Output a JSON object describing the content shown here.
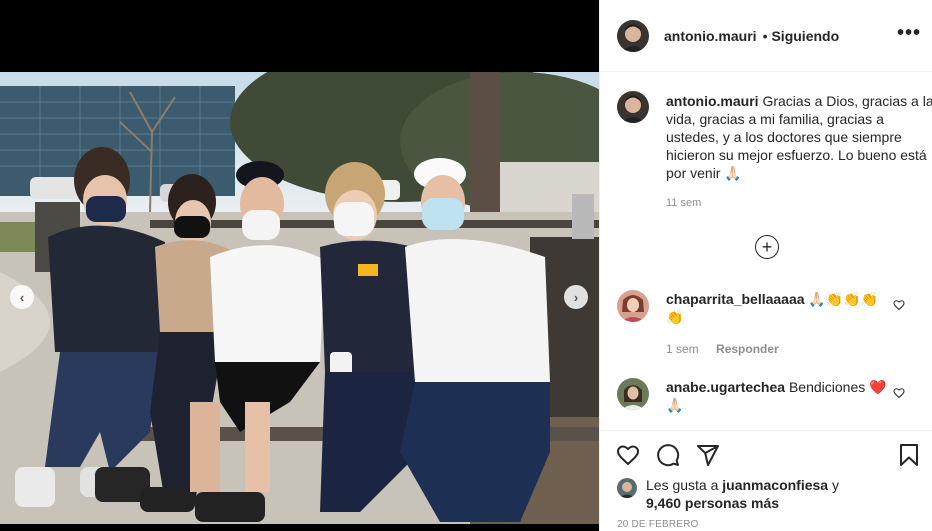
{
  "post": {
    "author": "antonio.mauri",
    "follow_status": "Siguiendo",
    "separator": "•",
    "more_icon": "more-horizontal-icon",
    "caption_text": "Gracias a Dios, gracias a la vida, gracias a mi familia, gracias a ustedes, y a los doctores que siempre hicieron su mejor esfuerzo. Lo bueno está por venir 🙏🏻",
    "caption_time": "11 sem",
    "load_more_symbol": "+"
  },
  "comments": [
    {
      "username": "chaparrita_bellaaaaa",
      "text": "🙏🏻👏👏👏 👏",
      "time": "1 sem",
      "reply_label": "Responder"
    },
    {
      "username": "anabe.ugartechea",
      "text": "Bendiciones ❤️🙏🏻"
    }
  ],
  "likes": {
    "prefix": "Les gusta a",
    "user": "juanmaconfiesa",
    "conjunction": "y",
    "count": "9,460 personas más"
  },
  "date": "20 DE FEBRERO",
  "nav": {
    "prev": "‹",
    "next": "›"
  },
  "colors": {
    "text": "#262626",
    "secondary": "#8e8e8e",
    "border": "#efefef"
  }
}
